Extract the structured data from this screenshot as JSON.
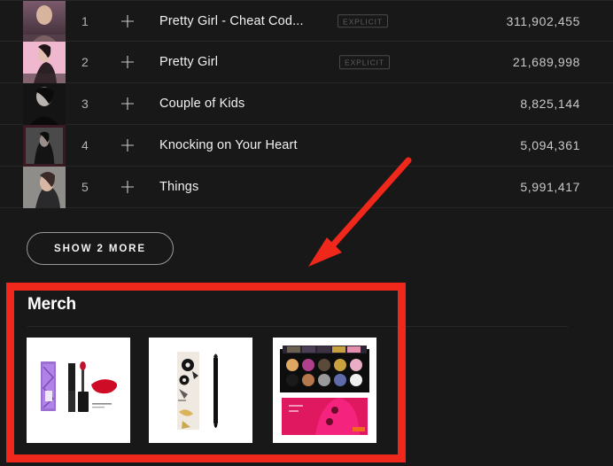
{
  "tracklist": {
    "columns": [
      "index",
      "add",
      "title",
      "explicit",
      "plays"
    ],
    "rows": [
      {
        "index": "1",
        "title": "Pretty Girl - Cheat Cod...",
        "explicit": "EXPLICIT",
        "has_explicit": true,
        "plays": "311,902,455",
        "add_icon": "plus-icon"
      },
      {
        "index": "2",
        "title": "Pretty Girl",
        "explicit": "EXPLICIT",
        "has_explicit": true,
        "plays": "21,689,998",
        "add_icon": "plus-icon"
      },
      {
        "index": "3",
        "title": "Couple of Kids",
        "explicit": "",
        "has_explicit": false,
        "plays": "8,825,144",
        "add_icon": "plus-icon"
      },
      {
        "index": "4",
        "title": "Knocking on Your Heart",
        "explicit": "",
        "has_explicit": false,
        "plays": "5,094,361",
        "add_icon": "plus-icon"
      },
      {
        "index": "5",
        "title": "Things",
        "explicit": "",
        "has_explicit": false,
        "plays": "5,991,417",
        "add_icon": "plus-icon"
      }
    ]
  },
  "show_more": {
    "label": "SHOW 2 MORE",
    "count": "2"
  },
  "merch": {
    "title": "Merch",
    "items": [
      {
        "name": "lipstick-product-card",
        "kind": "liquid-lipstick"
      },
      {
        "name": "eyeliner-product-card",
        "kind": "eye-pencil"
      },
      {
        "name": "eyeshadow-palette-card",
        "kind": "palette"
      }
    ]
  },
  "annotations": {
    "box_color": "#f0271b",
    "arrow_color": "#f0271b",
    "arrow_from": "460,180",
    "arrow_to": "353,300"
  },
  "colors": {
    "background": "#181818",
    "divider": "#262626",
    "text_primary": "#f2f2f2",
    "text_secondary": "#b3b3b3",
    "accent_red": "#f0271b"
  }
}
